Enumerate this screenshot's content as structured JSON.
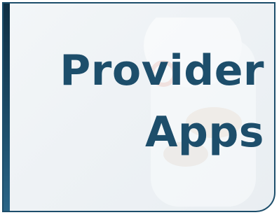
{
  "tile": {
    "title_line1": "Provider",
    "title_line2": "Apps"
  },
  "colors": {
    "accent": "#1d4e6b",
    "bar_dark": "#0f2f44",
    "background": "#eef2f5"
  }
}
